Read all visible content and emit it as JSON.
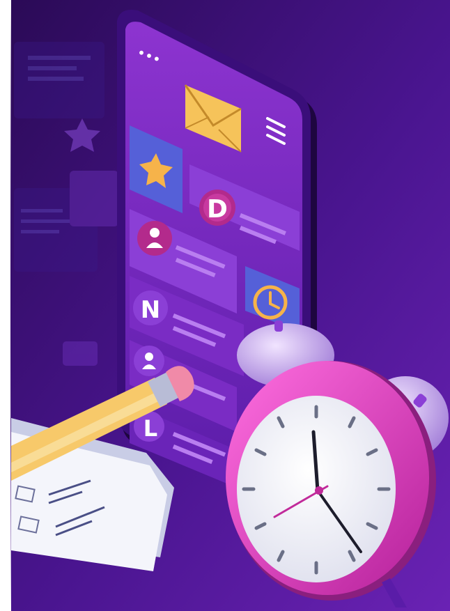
{
  "illustration": {
    "phone": {
      "dots": "•••",
      "avatar_letters": [
        "D",
        "N",
        "L"
      ]
    },
    "colors": {
      "background_dark": "#2c0a57",
      "background_light": "#6a1fb0",
      "phone_screen": "#7a2cc4",
      "card_blue": "#5560d8",
      "card_purple": "#8b3fd6",
      "badge_magenta": "#b32a8c",
      "accent_yellow": "#f6c35a",
      "clock_pink": "#e23fc7",
      "bell_lavender": "#c9a6f0",
      "pencil_yellow": "#f7c96a",
      "eraser_pink": "#f08aa8"
    },
    "icons": [
      "envelope-icon",
      "star-icon",
      "hamburger-icon",
      "person-icon",
      "clock-icon",
      "alarm-clock"
    ]
  }
}
